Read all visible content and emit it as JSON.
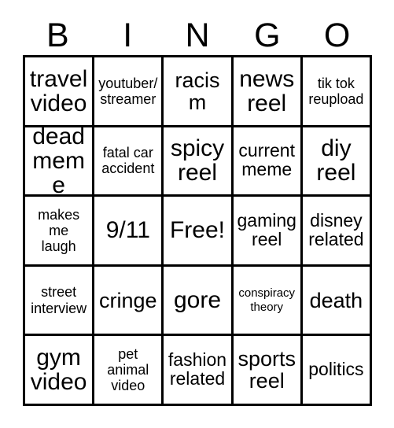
{
  "card": {
    "header_letters": [
      "B",
      "I",
      "N",
      "G",
      "O"
    ],
    "columns": 5,
    "rows": 5,
    "free_space_label": "Free!",
    "colors": {
      "border": "#000000",
      "background": "#ffffff",
      "text": "#000000"
    },
    "grid": [
      [
        {
          "text": "travel\nvideo",
          "size": "xl"
        },
        {
          "text": "youtuber/\nstreamer",
          "size": "sm"
        },
        {
          "text": "racism",
          "size": "lg"
        },
        {
          "text": "news\nreel",
          "size": "xl"
        },
        {
          "text": "tik tok\nreupload",
          "size": "sm"
        }
      ],
      [
        {
          "text": "dead\nmeme",
          "size": "xl"
        },
        {
          "text": "fatal car\naccident",
          "size": "sm"
        },
        {
          "text": "spicy\nreel",
          "size": "xl"
        },
        {
          "text": "current\nmeme",
          "size": "md"
        },
        {
          "text": "diy\nreel",
          "size": "xl"
        }
      ],
      [
        {
          "text": "makes\nme\nlaugh",
          "size": "sm"
        },
        {
          "text": "9/11",
          "size": "xl"
        },
        {
          "text": "Free!",
          "size": "xl"
        },
        {
          "text": "gaming\nreel",
          "size": "md"
        },
        {
          "text": "disney\nrelated",
          "size": "md"
        }
      ],
      [
        {
          "text": "street\ninterview",
          "size": "sm"
        },
        {
          "text": "cringe",
          "size": "lg"
        },
        {
          "text": "gore",
          "size": "xl"
        },
        {
          "text": "conspiracy\ntheory",
          "size": "xs"
        },
        {
          "text": "death",
          "size": "lg"
        }
      ],
      [
        {
          "text": "gym\nvideo",
          "size": "xl"
        },
        {
          "text": "pet\nanimal\nvideo",
          "size": "sm"
        },
        {
          "text": "fashion\nrelated",
          "size": "md"
        },
        {
          "text": "sports\nreel",
          "size": "lg"
        },
        {
          "text": "politics",
          "size": "md"
        }
      ]
    ]
  }
}
